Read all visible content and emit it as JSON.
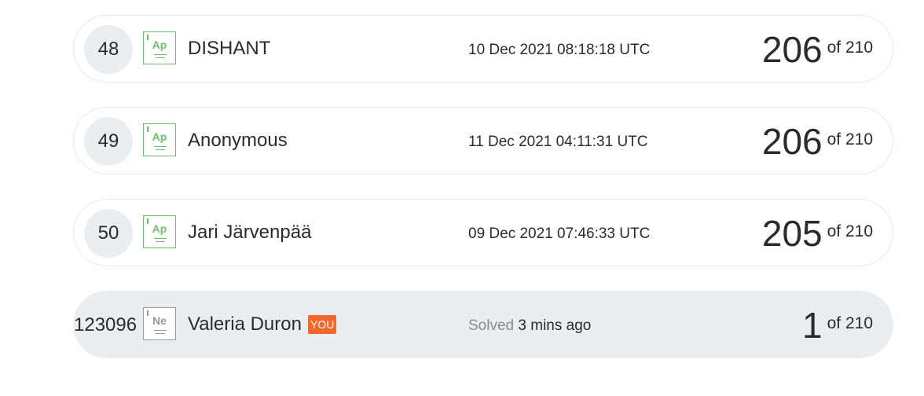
{
  "leaderboard": {
    "rows": [
      {
        "rank": "48",
        "badge": "Ap",
        "name": "DISHANT",
        "time": "10 Dec 2021 08:18:18 UTC",
        "score": "206",
        "of": "of 210"
      },
      {
        "rank": "49",
        "badge": "Ap",
        "name": "Anonymous",
        "time": "11 Dec 2021 04:11:31 UTC",
        "score": "206",
        "of": "of 210"
      },
      {
        "rank": "50",
        "badge": "Ap",
        "name": "Jari Järvenpää",
        "time": "09 Dec 2021 07:46:33 UTC",
        "score": "205",
        "of": "of 210"
      }
    ],
    "you": {
      "rank": "123096",
      "badge": "Ne",
      "name": "Valeria Duron",
      "tag": "YOU",
      "solved_prefix": "Solved",
      "time": "3 mins ago",
      "score": "1",
      "of": "of 210"
    }
  },
  "colors": {
    "badge_green": "#6cc16a",
    "badge_gray": "#9a9a9a",
    "you_tag": "#f2672e",
    "row_highlight": "#eaeef1"
  }
}
